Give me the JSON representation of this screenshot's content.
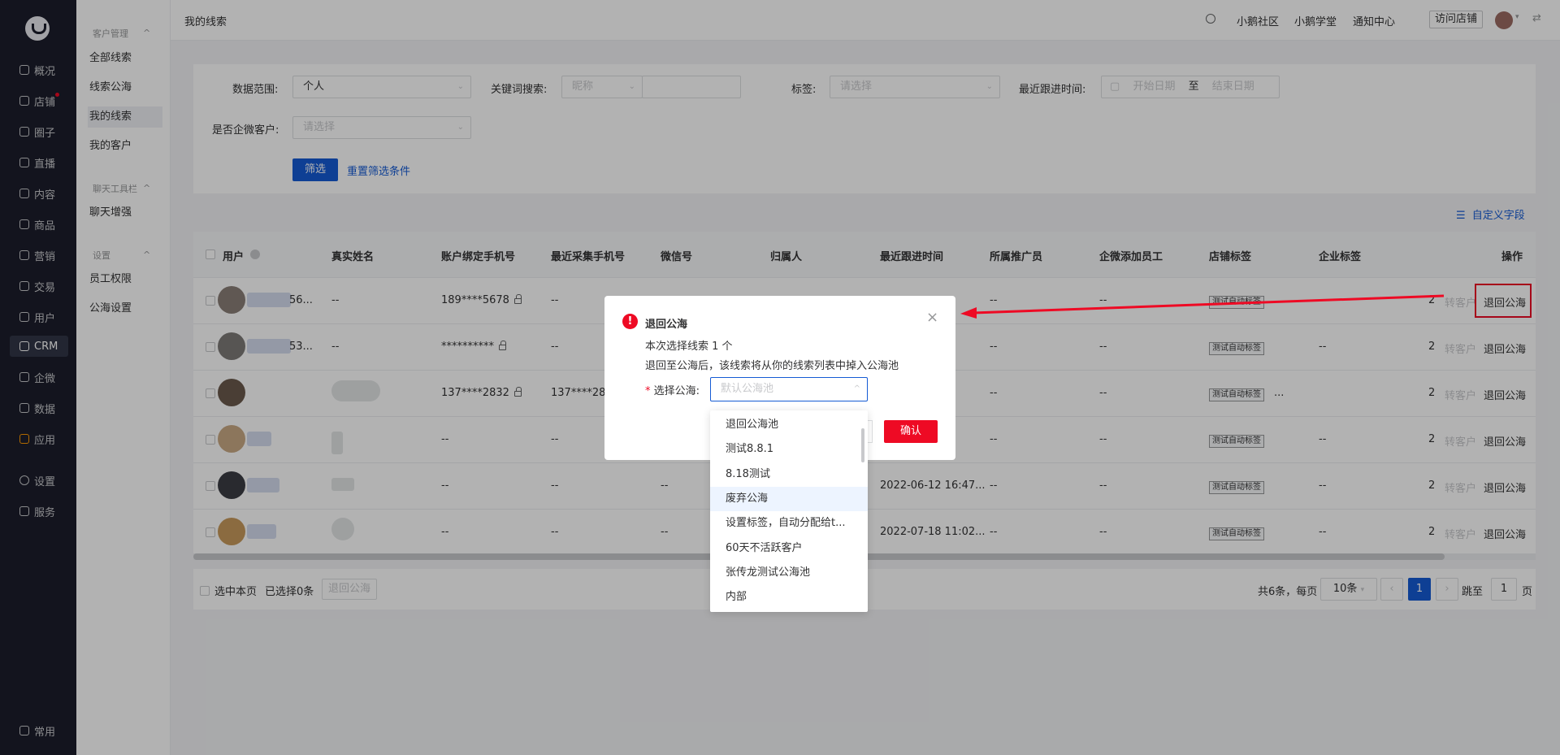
{
  "nav": {
    "items": [
      "概况",
      "店铺",
      "圈子",
      "直播",
      "内容",
      "商品",
      "营销",
      "交易",
      "用户",
      "CRM",
      "企微",
      "数据",
      "应用",
      "设置",
      "服务"
    ],
    "bottom": "常用"
  },
  "subnav": {
    "group1": "客户管理",
    "group1_items": [
      "全部线索",
      "线索公海",
      "我的线索",
      "我的客户"
    ],
    "group2": "聊天工具栏",
    "group2_items": [
      "聊天增强"
    ],
    "group3": "设置",
    "group3_items": [
      "员工权限",
      "公海设置"
    ]
  },
  "topbar": {
    "title": "我的线索",
    "links": [
      "小鹅社区",
      "小鹅学堂",
      "通知中心"
    ],
    "visit_store": "访问店铺"
  },
  "filters": {
    "scope_label": "数据范围:",
    "scope_value": "个人",
    "keyword_label": "关键词搜索:",
    "keyword_type": "昵称",
    "tag_label": "标签:",
    "tag_placeholder": "请选择",
    "follow_label": "最近跟进时间:",
    "start_placeholder": "开始日期",
    "date_sep": "至",
    "end_placeholder": "结束日期",
    "wework_label": "是否企微客户:",
    "wework_placeholder": "请选择",
    "filter_button": "筛选",
    "reset_link": "重置筛选条件"
  },
  "custom_fields": "自定义字段",
  "table": {
    "headers": [
      "用户",
      "真实姓名",
      "账户绑定手机号",
      "最近采集手机号",
      "微信号",
      "归属人",
      "最近跟进时间",
      "所属推广员",
      "企微添加员工",
      "店铺标签",
      "企业标签",
      "",
      "操作"
    ],
    "rows": [
      {
        "name_suffix": "56...",
        "real": "--",
        "bound": "189****5678",
        "collected": "--",
        "wechat": "",
        "owner": "",
        "follow": "",
        "promoter": "--",
        "staff": "--",
        "tag": "测试自动标签",
        "corp": "--",
        "extra": "2",
        "convert": "转客户",
        "action": "退回公海"
      },
      {
        "name_suffix": "53...",
        "real": "--",
        "bound": "**********",
        "collected": "--",
        "wechat": "",
        "owner": "",
        "follow": "",
        "promoter": "--",
        "staff": "--",
        "tag": "测试自动标签",
        "corp": "--",
        "extra": "2",
        "convert": "转客户",
        "action": "退回公海"
      },
      {
        "name_suffix": "",
        "real": "",
        "bound": "137****2832",
        "collected": "137****282",
        "wechat": "",
        "owner": "",
        "follow": "",
        "promoter": "--",
        "staff": "--",
        "tag": "测试自动标签",
        "corp": "...",
        "extra": "2",
        "convert": "转客户",
        "action": "退回公海"
      },
      {
        "name_suffix": "",
        "real": "",
        "bound": "--",
        "collected": "--",
        "wechat": "",
        "owner": "",
        "follow": "",
        "promoter": "--",
        "staff": "--",
        "tag": "测试自动标签",
        "corp": "--",
        "extra": "2",
        "convert": "转客户",
        "action": "退回公海"
      },
      {
        "name_suffix": "",
        "real": "",
        "bound": "--",
        "collected": "--",
        "wechat": "--",
        "owner": "",
        "follow": "2022-06-12 16:47...",
        "promoter": "--",
        "staff": "--",
        "tag": "测试自动标签",
        "corp": "--",
        "extra": "2",
        "convert": "转客户",
        "action": "退回公海"
      },
      {
        "name_suffix": "",
        "real": "",
        "bound": "--",
        "collected": "--",
        "wechat": "--",
        "owner": "",
        "follow": "2022-07-18 11:02...",
        "promoter": "--",
        "staff": "--",
        "tag": "测试自动标签",
        "corp": "--",
        "extra": "2",
        "convert": "转客户",
        "action": "退回公海"
      }
    ]
  },
  "footer": {
    "select_page": "选中本页",
    "selected": "已选择0条",
    "return_button": "退回公海",
    "total": "共6条，每页",
    "page_size": "10条",
    "current_page": "1",
    "jump_label": "跳至",
    "jump_value": "1",
    "page_unit": "页"
  },
  "dialog": {
    "title": "退回公海",
    "count_text": "本次选择线索 1 个",
    "desc": "退回至公海后，该线索将从你的线索列表中掉入公海池",
    "select_label": "选择公海:",
    "select_placeholder": "默认公海池",
    "confirm": "确认"
  },
  "dropdown": {
    "options": [
      "退回公海池",
      "测试8.8.1",
      "8.18测试",
      "废弃公海",
      "设置标签，自动分配给t...",
      "60天不活跃客户",
      "张传龙测试公海池",
      "内部"
    ],
    "highlighted_index": 3
  },
  "colors": {
    "primary": "#155bd4",
    "danger": "#ee0a24",
    "nav_bg": "#1c1e2b"
  }
}
